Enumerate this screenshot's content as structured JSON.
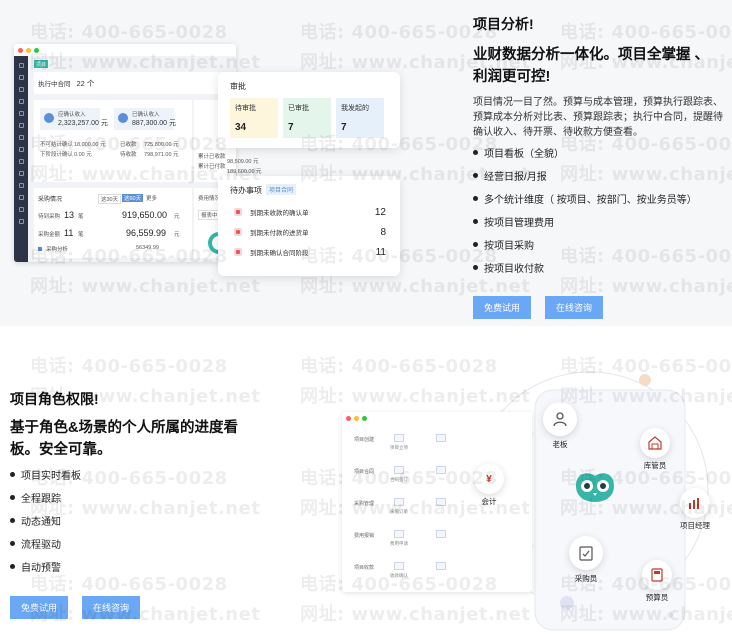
{
  "watermark": {
    "phone": "电话: 400-665-0028",
    "site": "网址: www.chanjet.net"
  },
  "section1": {
    "title": "项目分析!",
    "subtitle_line1": "业财数据分析一体化。项目全掌握 、",
    "subtitle_line2": "利润更可控!",
    "desc_line1": "项目情况一目了然。预算与成本管理，预算执行跟踪表、",
    "desc_line2": "预算成本分析对比表、预算跟踪表；执行中合同，提醒待",
    "desc_line3": "确认收入、待开票、待收款方便查看。",
    "bullets": [
      "项目看板（全貌）",
      "经营日报/月报",
      "多个统计维度（ 按项目、按部门、按业务员等）",
      "按项目管理费用",
      "按项目采购",
      "按项目收付款"
    ],
    "btn_trial": "免费试用",
    "btn_consult": "在线咨询"
  },
  "section2": {
    "title": "项目角色权限!",
    "subtitle_line1": "基于角色&场景的个人所属的进度看",
    "subtitle_line2": "板。安全可靠。",
    "bullets": [
      "项目实时看板",
      "全程跟踪",
      "动态通知",
      "流程驱动",
      "自动预警"
    ],
    "btn_trial": "免费试用",
    "btn_consult": "在线咨询"
  },
  "dashboard": {
    "tag": "项目",
    "contract_label": "执行中合同",
    "contract_count": "22 个",
    "card1_label": "应确认收入",
    "card1_value": "2,323,257.00 元",
    "card2_label": "已确认收入",
    "card2_value": "887,300.00 元",
    "row1_label": "不可结计确认",
    "row1_value": "18,000.00 元",
    "row2_label": "下阶段计确认",
    "row2_value": "0.00 元",
    "row3_label": "已收款",
    "row3_value": "725,800.00 元",
    "row4_label": "待收款",
    "row4_value": "798,971.00 元",
    "purchase_label": "采购情况",
    "purchase_tab1": "这30天",
    "purchase_tab2": "这60天",
    "purchase_tab3": "更多",
    "purchase_row1_label": "待到采购",
    "purchase_row1_count": "13",
    "purchase_row1_unit": "笔",
    "purchase_row1_value": "919,650.00",
    "purchase_row2_label": "采购金额",
    "purchase_row2_count": "11",
    "purchase_row2_unit": "笔",
    "purchase_row2_value": "96,559.99",
    "purchase_footer_label": "采购分析",
    "purchase_footer_value": "56349.99",
    "unit_yuan": "元",
    "fee_label": "费用情况",
    "fee_button": "报表中",
    "paid_label": "累计已收款",
    "paid_value": "98,509.00 元",
    "paid2_label": "累计已付款",
    "paid2_value": "189,600.00 元"
  },
  "approval": {
    "title": "审批",
    "items": [
      {
        "label": "待审批",
        "count": "34",
        "bg": "#fdf5dc"
      },
      {
        "label": "已审批",
        "count": "7",
        "bg": "#e4f5ec"
      },
      {
        "label": "我发起的",
        "count": "7",
        "bg": "#e6f0fb"
      }
    ]
  },
  "todo": {
    "title": "待办事项",
    "tag": "项目合同",
    "items": [
      {
        "label": "到期未收款的确认单",
        "count": "12"
      },
      {
        "label": "到期未付款的进货单",
        "count": "8"
      },
      {
        "label": "到期未确认合同阶段",
        "count": "11"
      }
    ]
  },
  "roles": {
    "boss": "老板",
    "warehouse": "库管员",
    "accountant": "会计",
    "manager": "项目经理",
    "purchaser": "采购员",
    "budget": "预算员"
  },
  "flow": {
    "rows": [
      "项目创建",
      "项目合同",
      "采购管理",
      "费用报销",
      "项目收款"
    ],
    "labels": [
      "项目立项",
      "合同签订",
      "采购订单",
      "费用申请",
      "收款确认"
    ],
    "yuan_symbol": "¥"
  },
  "colors": {
    "button": "#6aa7f4",
    "sidebar": "#2e3447",
    "accent_teal": "#37b6a8"
  }
}
